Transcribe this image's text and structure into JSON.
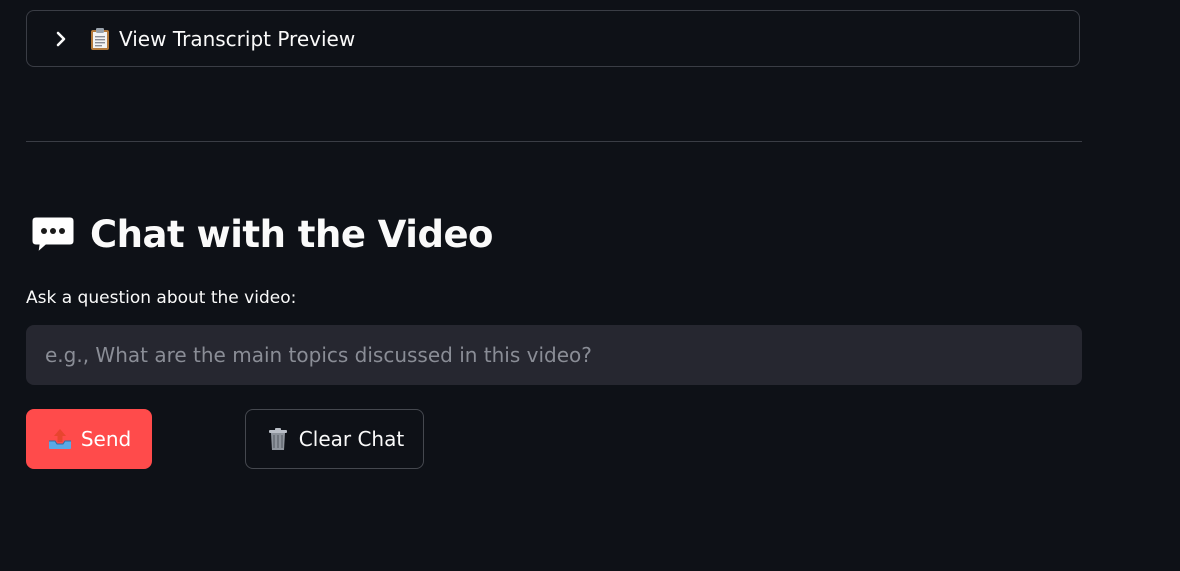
{
  "expander": {
    "label": "View Transcript Preview",
    "icon": "clipboard-icon",
    "chevron": "chevron-right-icon"
  },
  "section": {
    "title": "Chat with the Video",
    "icon": "speech-bubble-icon"
  },
  "question": {
    "label": "Ask a question about the video:",
    "placeholder": "e.g., What are the main topics discussed in this video?",
    "value": ""
  },
  "buttons": {
    "send_label": "Send",
    "send_icon": "outbox-tray-icon",
    "clear_label": "Clear Chat",
    "clear_icon": "wastebasket-icon"
  },
  "colors": {
    "background": "#0e1117",
    "primary": "#ff4b4b",
    "input_bg": "#262730",
    "border": "#3a3d45",
    "text": "#fafafa"
  }
}
